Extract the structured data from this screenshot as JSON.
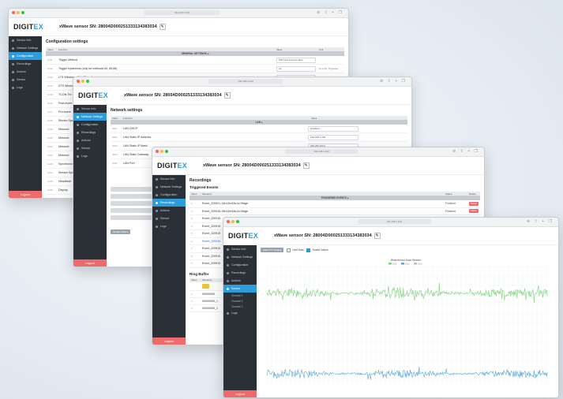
{
  "brand": {
    "logo_main": "DIGIT",
    "logo_accent": "EX"
  },
  "sensor_title": "xWave sensor SN: 28004D000251333134383034",
  "url_text": "192.168.1.100",
  "sidebar": {
    "items": [
      "Sensor Info",
      "Network Settings",
      "Configuration",
      "Recordings",
      "Actions",
      "Sensor",
      "Logs"
    ],
    "sensor_sub": [
      "Channel 1",
      "Channel 2",
      "Channel 3"
    ],
    "logout": "Logout"
  },
  "config": {
    "heading": "Configuration settings",
    "columns": [
      "Index",
      "Function",
      "Value",
      "Unit"
    ],
    "group": "GENERAL SETTINGS ▴",
    "rows": [
      {
        "id": "1011",
        "name": "Trigger Method",
        "value": "SW (Use interval value",
        "unit": ""
      },
      {
        "id": "1012",
        "name": "Trigger hysteresis (only for methods 64, 65,66)",
        "value": "10",
        "unit": "% of thr. Trigcount"
      },
      {
        "id": "1013",
        "name": "LTS Window - (0 to 30 sec)",
        "value": "10",
        "unit": "Seconds"
      },
      {
        "id": "1014",
        "name": "STS Window - (0 to 5 sec)",
        "value": "10",
        "unit": "Seconds"
      },
      {
        "id": "1015",
        "name": "TCOfs Thr",
        "value": "",
        "unit": ""
      },
      {
        "id": "1016",
        "name": "Post-event",
        "value": "",
        "unit": ""
      },
      {
        "id": "1017",
        "name": "Pre-event",
        "value": "",
        "unit": ""
      },
      {
        "id": "1018",
        "name": "Stream Sys",
        "value": "",
        "unit": ""
      },
      {
        "id": "1019",
        "name": "Mirrored",
        "value": "",
        "unit": ""
      },
      {
        "id": "1020",
        "name": "Mirrored",
        "value": "",
        "unit": ""
      },
      {
        "id": "1021",
        "name": "Mirrored",
        "value": "",
        "unit": ""
      },
      {
        "id": "1022",
        "name": "Mirrored",
        "value": "",
        "unit": ""
      },
      {
        "id": "1023",
        "name": "Synchronize",
        "value": "",
        "unit": ""
      },
      {
        "id": "1024",
        "name": "Stream Sys",
        "value": "",
        "unit": ""
      },
      {
        "id": "1025",
        "name": "Heartbeat",
        "value": "",
        "unit": ""
      },
      {
        "id": "1026",
        "name": "Display",
        "value": "",
        "unit": ""
      }
    ]
  },
  "network": {
    "heading": "Network settings",
    "columns": [
      "Index",
      "Function",
      "Value"
    ],
    "group": "LAN ▴",
    "rows": [
      {
        "id": "3001",
        "name": "LAN DHCP",
        "value": "Disabled"
      },
      {
        "id": "3002",
        "name": "LAN Static IP Address",
        "value": "192.168.1.100"
      },
      {
        "id": "3003",
        "name": "LAN Static IP Mask",
        "value": "255.255.255.0"
      },
      {
        "id": "3004",
        "name": "LAN Static Gateway",
        "value": "192.168.1.1"
      },
      {
        "id": "3005",
        "name": "LAN Port",
        "value": "80"
      }
    ],
    "update_button": "Update Values"
  },
  "recordings": {
    "heading": "Recordings",
    "triggered_heading": "Triggered Events",
    "columns": [
      "Index",
      "Filename",
      "Status",
      "Delete"
    ],
    "group": "TRIGGERED EVENTS ▴",
    "rows": [
      {
        "id": "1",
        "name": "Event_220921-14h13m43s-Id-Stage",
        "status": "Finished"
      },
      {
        "id": "2",
        "name": "Event_220916-15h13m44s-Id-Stage",
        "status": "Finished"
      },
      {
        "id": "3",
        "name": "Event_220915",
        "status": ""
      },
      {
        "id": "4",
        "name": "Event_220915",
        "status": ""
      },
      {
        "id": "5",
        "name": "Event_220915",
        "status": ""
      },
      {
        "id": "6",
        "name": "Event_220915",
        "status": ""
      },
      {
        "id": "7",
        "name": "Event_220915",
        "status": ""
      },
      {
        "id": "8",
        "name": "Event_220915",
        "status": ""
      },
      {
        "id": "9",
        "name": "Event_220915",
        "status": ""
      }
    ],
    "delete_label": "Delete",
    "ring_heading": "Ring Buffer",
    "ring_columns": [
      "Index",
      "Filename"
    ],
    "ring_rows": [
      {
        "id": "1",
        "name": "00000000"
      },
      {
        "id": "2",
        "name": "00000000_1"
      },
      {
        "id": "3",
        "name": "00000000_1"
      }
    ]
  },
  "sensor_view": {
    "start_button": "Start FFT Display",
    "hold_label": "Hold Data",
    "scaled_label": "Scaled Values",
    "chart_title": "Waterfound Data Stream",
    "legend": [
      "Ch 1",
      "Ch 2",
      "Ch 3"
    ],
    "colors": {
      "green": "#7ed37a",
      "blue": "#56a9d6",
      "grid": "#eceef1"
    }
  },
  "colors": {
    "accent": "#2d9cdb",
    "sidebar": "#2b2f36",
    "logout": "#ef6b6b"
  }
}
